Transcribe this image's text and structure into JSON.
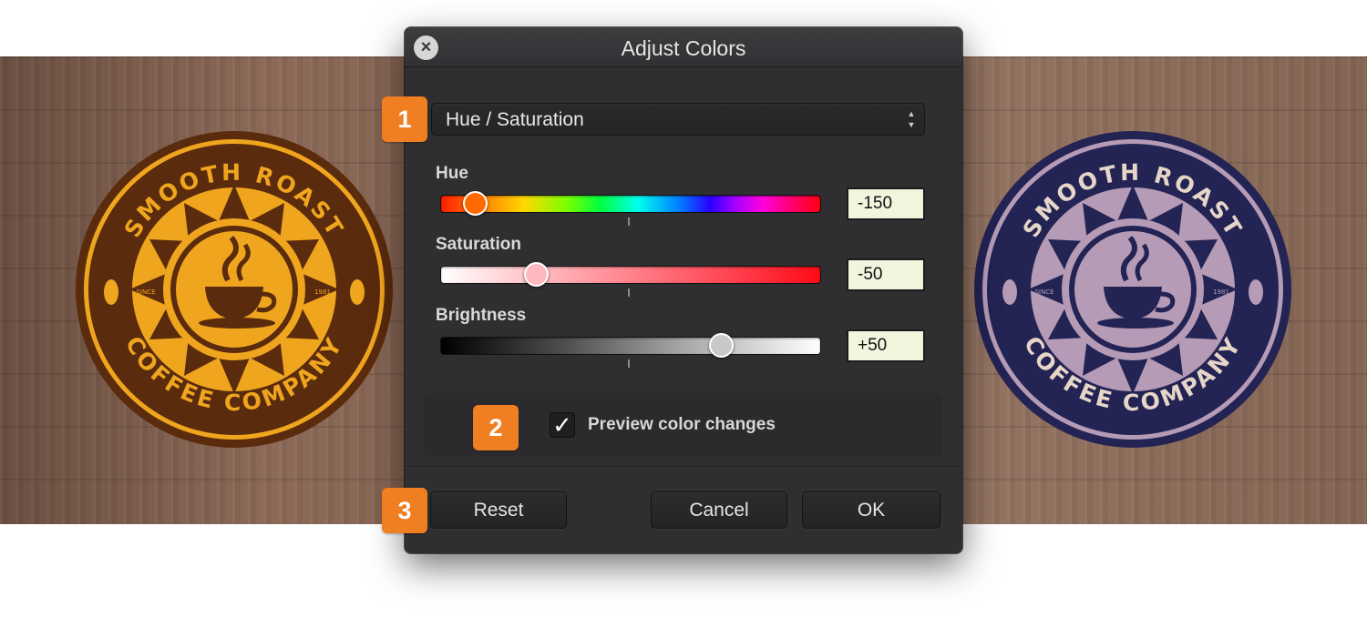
{
  "dialog": {
    "title": "Adjust Colors"
  },
  "mode_select": {
    "value": "Hue / Saturation"
  },
  "sliders": [
    {
      "label": "Hue",
      "value": "-150",
      "position": 0.09,
      "thumb_color": "#ff6a00"
    },
    {
      "label": "Saturation",
      "value": "-50",
      "position": 0.25,
      "thumb_color": "#ffb8c0"
    },
    {
      "label": "Brightness",
      "value": "+50",
      "position": 0.74,
      "thumb_color": "#c8c8c8"
    }
  ],
  "preview": {
    "label": "Preview color changes",
    "checked": true
  },
  "buttons": {
    "reset": "Reset",
    "cancel": "Cancel",
    "ok": "OK"
  },
  "steps": [
    "1",
    "2",
    "3"
  ],
  "badge": {
    "top_text": "SMOOTH ROAST",
    "bottom_text": "COFFEE COMPANY",
    "since": "SINCE",
    "year": "1981"
  },
  "colors": {
    "accent": "#f07f22",
    "badge_original_fill": "#f0a51e",
    "badge_original_dark": "#5a2b0c",
    "badge_adjusted_fill": "#b59bb5",
    "badge_adjusted_dark": "#232354"
  }
}
